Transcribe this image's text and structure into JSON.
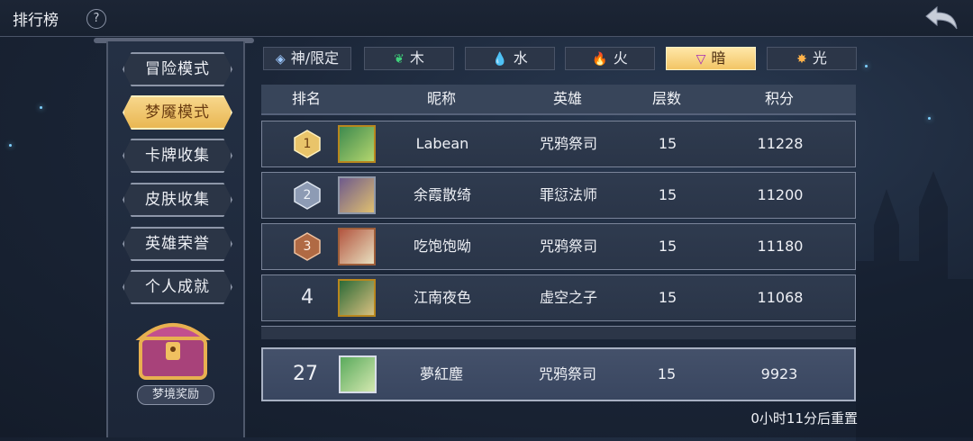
{
  "header": {
    "title": "排行榜"
  },
  "menu": [
    {
      "label": "冒险模式",
      "active": false
    },
    {
      "label": "梦魇模式",
      "active": true
    },
    {
      "label": "卡牌收集",
      "active": false
    },
    {
      "label": "皮肤收集",
      "active": false
    },
    {
      "label": "英雄荣誉",
      "active": false
    },
    {
      "label": "个人成就",
      "active": false
    }
  ],
  "reward": {
    "label": "梦境奖励"
  },
  "tabs": [
    {
      "label": "神/限定",
      "icon": "◈",
      "color": "#9cc8ff",
      "active": false
    },
    {
      "label": "木",
      "icon": "❦",
      "color": "#3fcf7a",
      "active": false
    },
    {
      "label": "水",
      "icon": "💧",
      "color": "#4aa8ff",
      "active": false
    },
    {
      "label": "火",
      "icon": "🔥",
      "color": "#e23a2a",
      "active": false
    },
    {
      "label": "暗",
      "icon": "▽",
      "color": "#a22bb8",
      "active": true
    },
    {
      "label": "光",
      "icon": "✸",
      "color": "#ffb24a",
      "active": false
    }
  ],
  "table": {
    "headers": {
      "rank": "排名",
      "name": "昵称",
      "hero": "英雄",
      "floor": "层数",
      "score": "积分"
    },
    "rows": [
      {
        "rank": "1",
        "name": "Labean",
        "hero": "咒鸦祭司",
        "floor": "15",
        "score": "11228"
      },
      {
        "rank": "2",
        "name": "余霞散绮",
        "hero": "罪愆法师",
        "floor": "15",
        "score": "11200"
      },
      {
        "rank": "3",
        "name": "吃饱饱呦",
        "hero": "咒鸦祭司",
        "floor": "15",
        "score": "11180"
      },
      {
        "rank": "4",
        "name": "江南夜色",
        "hero": "虚空之子",
        "floor": "15",
        "score": "11068"
      }
    ]
  },
  "self_row": {
    "rank": "27",
    "name": "夢紅塵",
    "hero": "咒鸦祭司",
    "floor": "15",
    "score": "9923"
  },
  "reset_text": "0小时11分后重置"
}
